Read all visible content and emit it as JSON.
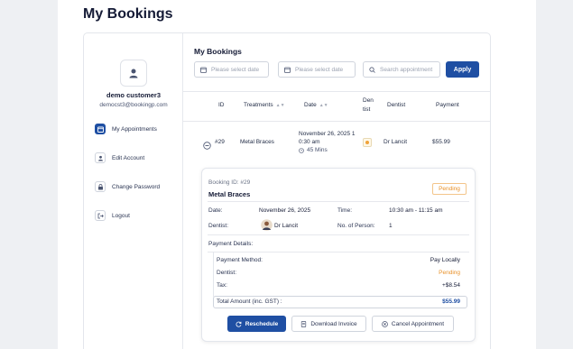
{
  "page_title": "My Bookings",
  "sidebar": {
    "user_name": "demo customer3",
    "user_email": "democst3@bookingp.com",
    "items": [
      {
        "label": "My Appointments",
        "icon": "calendar-icon",
        "active": true
      },
      {
        "label": "Edit Account",
        "icon": "user-icon",
        "active": false
      },
      {
        "label": "Change Password",
        "icon": "lock-icon",
        "active": false
      },
      {
        "label": "Logout",
        "icon": "logout-icon",
        "active": false
      }
    ]
  },
  "main": {
    "title": "My Bookings",
    "filters": {
      "date_from_placeholder": "Please select date",
      "date_to_placeholder": "Please select date",
      "search_placeholder": "Search appointment",
      "apply_label": "Apply"
    },
    "table": {
      "headers": [
        "ID",
        "Treatments",
        "Date",
        "Dentist",
        "Dentist",
        "Payment"
      ],
      "row": {
        "id": "#29",
        "treatment": "Metal Braces",
        "date": "November 26, 2025 1",
        "time": "0:30 am",
        "duration": "45 Mins",
        "status_color": "#f0a33a",
        "dentist": "Dr Lancit",
        "payment": "$55.99"
      }
    },
    "detail": {
      "booking_id": "Booking ID: #29",
      "treatment": "Metal Braces",
      "status": "Pending",
      "date_label": "Date:",
      "date_value": "November 26, 2025",
      "time_label": "Time:",
      "time_value": "10:30 am - 11:15 am",
      "dentist_label": "Dentist:",
      "dentist_value": "Dr Lancit",
      "persons_label": "No. of Person:",
      "persons_value": "1",
      "payment_details_label": "Payment Details:",
      "payment_method_label": "Payment Method:",
      "payment_method_value": "Pay Locally",
      "dentist_status_label": "Dentist:",
      "dentist_status_value": "Pending",
      "tax_label": "Tax:",
      "tax_value": "+$8.54",
      "total_label": "Total Amount (inc. GST) :",
      "total_value": "$55.99",
      "buttons": {
        "reschedule": "Reschedule",
        "download": "Download Invoice",
        "cancel": "Cancel Appointment"
      }
    }
  },
  "colors": {
    "accent": "#1f4fa3",
    "pending": "#e8912a",
    "total": "#1f4fa3"
  }
}
